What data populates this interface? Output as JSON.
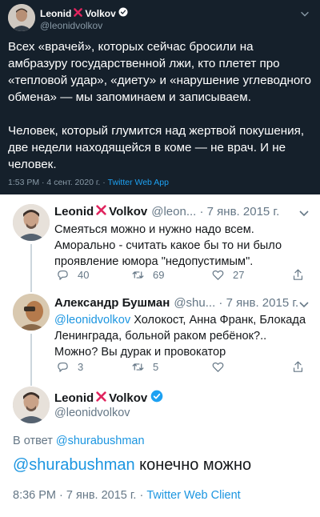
{
  "top_tweet": {
    "name_first": "Leonid",
    "name_last": "Volkov",
    "handle": "@leonidvolkov",
    "text": "Всех «врачей», которых сейчас бросили на амбразуру государственной лжи, кто плетет про «тепловой удар», «диету» и «нарушение углеводного обмена» — мы запоминаем и записываем.\n\nЧеловек, который глумится над жертвой покушения, две недели находящейся в коме — не врач. И не человек.",
    "time": "1:53 PM · 4 сент. 2020 г.",
    "separator": " · ",
    "app": "Twitter Web App"
  },
  "replies": [
    {
      "name_first": "Leonid",
      "name_last": "Volkov",
      "rest": "@leon... · 7 янв. 2015 г.",
      "text": "Смеяться можно и нужно надо всем. Аморально - считать какое бы то ни было проявление юмора \"недопустимым\".",
      "reply_count": "40",
      "retweet_count": "69",
      "like_count": "27"
    },
    {
      "name": "Александр Бушман",
      "rest": "@shu... · 7 янв. 2015 г.",
      "mention": "@leonidvolkov",
      "text": " Холокост, Анна Франк, Блокада Ленинграда, больной раком ребёнок?.. Можно? Вы дурак и провокатор",
      "reply_count": "3",
      "retweet_count": "5",
      "like_count": ""
    }
  ],
  "main_tweet": {
    "name_first": "Leonid",
    "name_last": "Volkov",
    "handle": "@leonidvolkov",
    "reply_to_prefix": "В ответ ",
    "reply_to_mention": "@shurabushman",
    "mention": "@shurabushman",
    "text": " конечно можно",
    "time": "8:36 PM · 7 янв. 2015 г.",
    "separator": " · ",
    "app": "Twitter Web Client"
  },
  "colors": {
    "dark_bg": "#15202b",
    "accent": "#1da1f2",
    "like_red": "#e0245e",
    "muted": "#657786"
  }
}
